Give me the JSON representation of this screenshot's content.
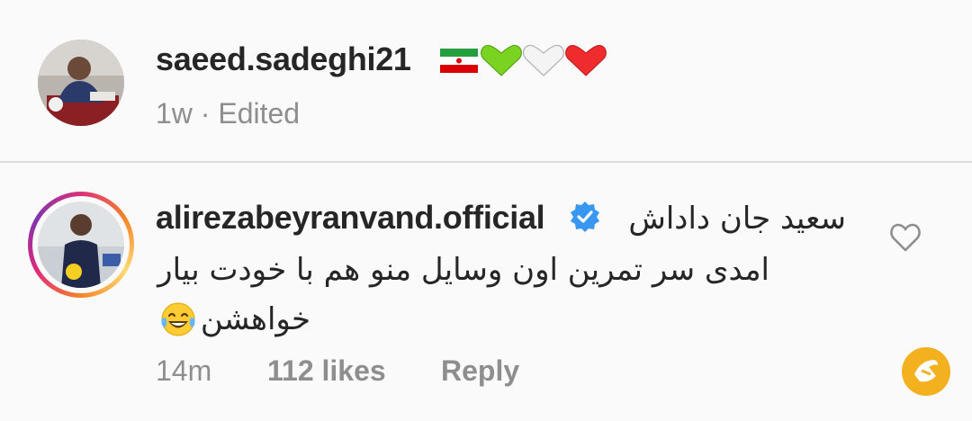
{
  "post": {
    "username": "saeed.sadeghi21",
    "meta": "1w · Edited",
    "emojis": [
      "iran-flag",
      "green-heart",
      "white-heart",
      "red-heart"
    ]
  },
  "comment": {
    "username": "alirezabeyranvand.official",
    "verified": true,
    "text_lines": [
      "سعید جان داداش",
      "امدی سر تمرین اون وسایل منو هم با خودت بیار",
      "خواهشن"
    ],
    "emoji": "face-with-tears-of-joy",
    "time": "14m",
    "likes": "112 likes",
    "reply_label": "Reply"
  },
  "colors": {
    "background": "#fafafa",
    "text": "#262626",
    "muted": "#8e8e8e",
    "verified_blue": "#3897f0",
    "watermark": "#f3b120"
  }
}
